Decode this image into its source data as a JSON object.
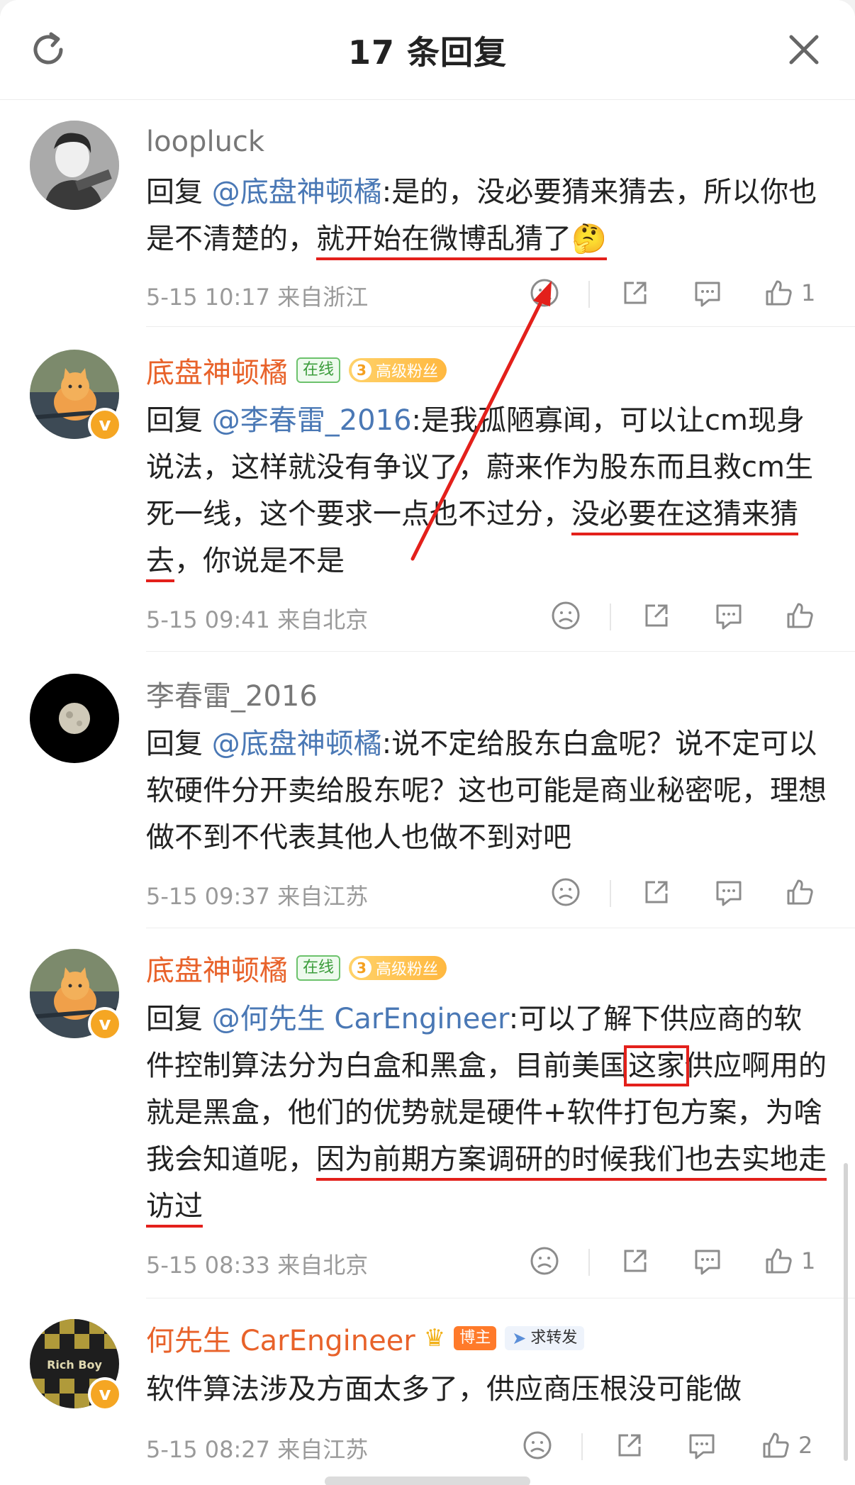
{
  "header": {
    "title": "17 条回复"
  },
  "comments": [
    {
      "user": "loopluck",
      "reply_prefix": "回复 ",
      "mention": "@底盘神顿橘",
      "text_a": ":是的，没必要猜来猜去，所以你也是不清楚的，",
      "text_hl": "就开始在微博乱猜了",
      "emoji": "🤔",
      "time": "5-15 10:17",
      "location": "来自浙江",
      "likes": "1"
    },
    {
      "user": "底盘神顿橘",
      "online": "在线",
      "fan_level": "3",
      "fan_label": "高级粉丝",
      "reply_prefix": "回复 ",
      "mention": "@李春雷_2016",
      "text_a": ":是我孤陋寡闻，可以让cm现身说法，这样就没有争议了，蔚来作为股东而且救cm生死一线，这个要求一点也不过分，",
      "text_hl": "没必要在这猜来猜去",
      "text_b": "，你说是不是",
      "time": "5-15 09:41",
      "location": "来自北京",
      "likes": ""
    },
    {
      "user": "李春雷_2016",
      "reply_prefix": "回复 ",
      "mention": "@底盘神顿橘",
      "text_a": ":说不定给股东白盒呢？说不定可以软硬件分开卖给股东呢？这也可能是商业秘密呢，理想做不到不代表其他人也做不到对吧",
      "time": "5-15 09:37",
      "location": "来自江苏",
      "likes": ""
    },
    {
      "user": "底盘神顿橘",
      "online": "在线",
      "fan_level": "3",
      "fan_label": "高级粉丝",
      "reply_prefix": "回复 ",
      "mention": "@何先生 CarEngineer",
      "text_a": ":可以了解下供应商的软件控制算法分为白盒和黑盒，目前美国",
      "text_box": "这家",
      "text_b": "供应啊用的就是黑盒，他们的优势就是硬件+软件打包方案，为啥我会知道呢，",
      "text_hl": "因为前期方案调研的时候我们也去实地走访过",
      "time": "5-15 08:33",
      "location": "来自北京",
      "likes": "1"
    },
    {
      "user": "何先生 CarEngineer",
      "blogger_tag": "博主",
      "forward_tag": "求转发",
      "avatar_text": "Rich Boy",
      "text_a": "软件算法涉及方面太多了，供应商压根没可能做",
      "time": "5-15 08:27",
      "location": "来自江苏",
      "likes": "2"
    }
  ],
  "colors": {
    "orange_name": "#e8622a",
    "mention_blue": "#4a78b5",
    "annotation_red": "#e3201b",
    "meta_gray": "#9a9a9a"
  },
  "icons": [
    "refresh-icon",
    "close-icon",
    "dislike-face-icon",
    "share-icon",
    "comment-icon",
    "like-icon",
    "verified-badge-icon",
    "crown-icon",
    "plane-icon"
  ]
}
